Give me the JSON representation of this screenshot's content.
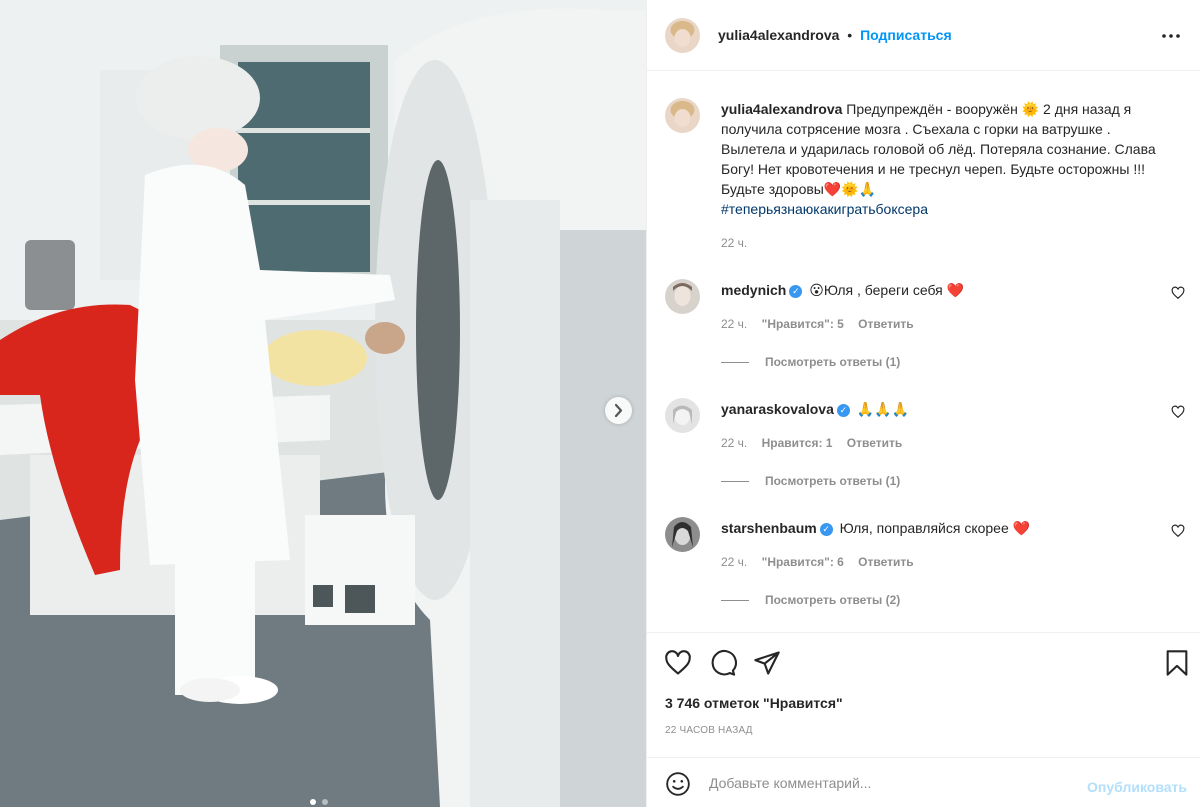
{
  "post": {
    "author": "yulia4alexandrova",
    "separator": "•",
    "follow_label": "Подписаться",
    "more_icon": "more-icon",
    "carousel_next_icon": "chevron-right-icon",
    "carousel": {
      "index": 1,
      "count": 2
    },
    "caption": {
      "text": "Предупреждён - вооружён 🌞 2 дня назад я получила сотрясение мозга . Съехала с горки на ватрушке . Вылетела и ударилась головой об лёд. Потеряла сознание. Слава Богу! Нет кровотечения и не треснул череп. Будьте осторожны !!! Будьте здоровы❤️🌞🙏",
      "hashtag": "#теперьязнаюкакигратьбоксера",
      "time": "22 ч."
    }
  },
  "comments": [
    {
      "user": "medynich",
      "verified": true,
      "text": "😮Юля , береги себя ❤️",
      "time": "22 ч.",
      "likes": "\"Нравится\": 5",
      "reply": "Ответить",
      "view_replies": "Посмотреть ответы (1)"
    },
    {
      "user": "yanaraskovalova",
      "verified": true,
      "text": "🙏🙏🙏",
      "time": "22 ч.",
      "likes": "Нравится: 1",
      "reply": "Ответить",
      "view_replies": "Посмотреть ответы (1)"
    },
    {
      "user": "starshenbaum",
      "verified": true,
      "text": "Юля, поправляйся скорее ❤️",
      "time": "22 ч.",
      "likes": "\"Нравится\": 6",
      "reply": "Ответить",
      "view_replies": "Посмотреть ответы (2)"
    }
  ],
  "actions": {
    "icons": [
      "heart-icon",
      "comment-icon",
      "share-icon",
      "bookmark-icon"
    ],
    "likes_count": "3 746 отметок \"Нравится\"",
    "posted_ago": "22 часов назад"
  },
  "add_comment": {
    "emoji_icon": "emoji-icon",
    "placeholder": "Добавьте комментарий...",
    "publish_label": "Опубликовать"
  },
  "colors": {
    "accent": "#0095f6",
    "publish_disabled": "#b2dffc",
    "like_red": "#ed4956",
    "muted": "#8e8e8e"
  }
}
